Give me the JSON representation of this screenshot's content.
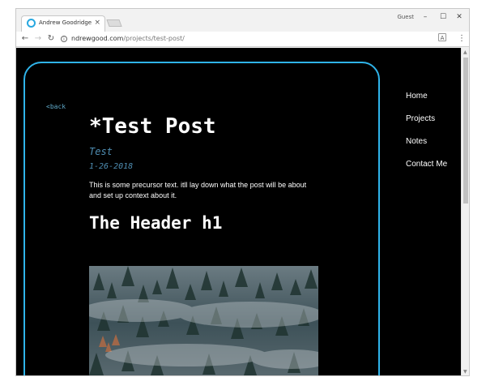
{
  "browser": {
    "tab_title": "Andrew Goodridge",
    "tab_close": "×",
    "profile": "Guest",
    "window_controls": {
      "minimize": "–",
      "maximize": "☐",
      "close": "✕"
    },
    "url_host": "ndrewgood.com",
    "url_path": "/projects/test-post/",
    "accent_color": "#28a8e0"
  },
  "post": {
    "back_label": "<back",
    "title": "*Test Post",
    "subtitle": "Test",
    "date": "1-26-2018",
    "intro": "This is some precursor text. itll lay down what the post will be about and set up context about it.",
    "header_h1": "The Header h1",
    "image_icon": "forest-photo"
  },
  "site_nav": {
    "items": [
      {
        "label": "Home"
      },
      {
        "label": "Projects"
      },
      {
        "label": "Notes"
      },
      {
        "label": "Contact Me"
      }
    ]
  },
  "theme": {
    "page_bg": "#000000",
    "card_border": "#2fb4ea",
    "link_color": "#4f8eb3"
  }
}
